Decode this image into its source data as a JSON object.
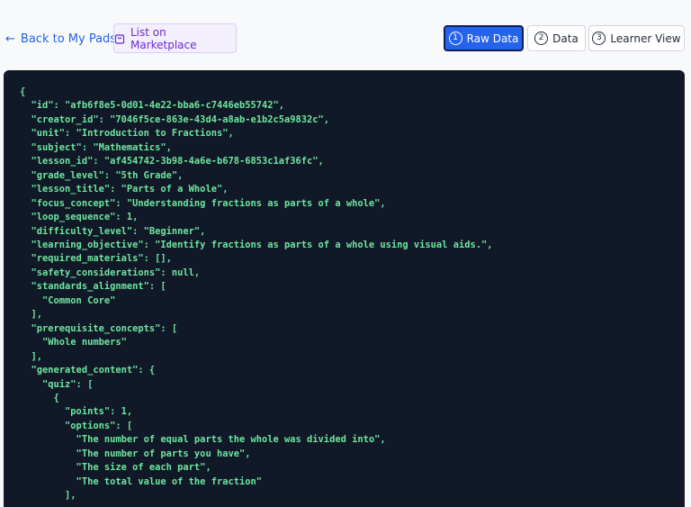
{
  "toolbar": {
    "back_label": "Back to My Pads",
    "marketplace_label": "List on Marketplace",
    "views": [
      {
        "num": "1",
        "label": "Raw Data",
        "active": true
      },
      {
        "num": "2",
        "label": "Data",
        "active": false
      },
      {
        "num": "3",
        "label": "Learner View",
        "active": false
      }
    ]
  },
  "colors": {
    "accent": "#2563eb",
    "code_bg": "#111827",
    "code_text": "#6ee7a0",
    "marketplace": "#6d28d9"
  },
  "code_lines": [
    "{",
    "  \"id\": \"afb6f8e5-0d01-4e22-bba6-c7446eb55742\",",
    "  \"creator_id\": \"7046f5ce-863e-43d4-a8ab-e1b2c5a9832c\",",
    "  \"unit\": \"Introduction to Fractions\",",
    "  \"subject\": \"Mathematics\",",
    "  \"lesson_id\": \"af454742-3b98-4a6e-b678-6853c1af36fc\",",
    "  \"grade_level\": \"5th Grade\",",
    "  \"lesson_title\": \"Parts of a Whole\",",
    "  \"focus_concept\": \"Understanding fractions as parts of a whole\",",
    "  \"loop_sequence\": 1,",
    "  \"difficulty_level\": \"Beginner\",",
    "  \"learning_objective\": \"Identify fractions as parts of a whole using visual aids.\",",
    "  \"required_materials\": [],",
    "  \"safety_considerations\": null,",
    "  \"standards_alignment\": [",
    "    \"Common Core\"",
    "  ],",
    "  \"prerequisite_concepts\": [",
    "    \"Whole numbers\"",
    "  ],",
    "  \"generated_content\": {",
    "    \"quiz\": [",
    "      {",
    "        \"points\": 1,",
    "        \"options\": [",
    "          \"The number of equal parts the whole was divided into\",",
    "          \"The number of parts you have\",",
    "          \"The size of each part\",",
    "          \"The total value of the fraction\"",
    "        ],"
  ]
}
